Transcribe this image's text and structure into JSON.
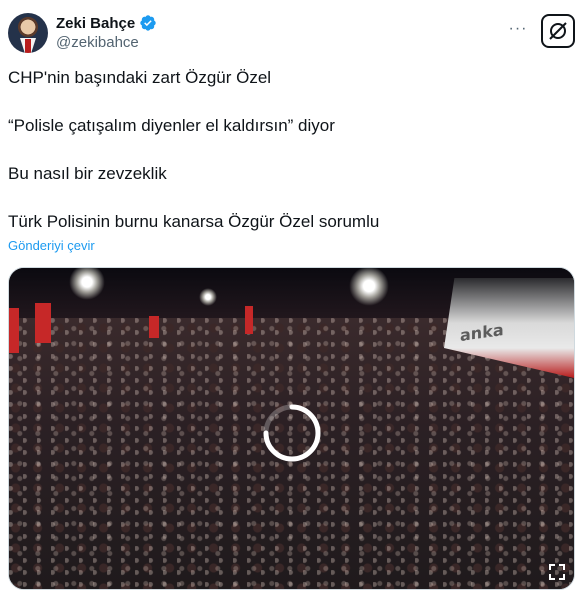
{
  "author": {
    "display_name": "Zeki Bahçe",
    "handle": "@zekibahce",
    "verified": true
  },
  "tweet": {
    "paragraphs": [
      "CHP'nin başındaki zart Özgür Özel",
      "“Polisle çatışalım diyenler el kaldırsın” diyor",
      "Bu nasıl bir zevzeklik",
      "Türk Polisinin burnu kanarsa Özgür Özel sorumlu"
    ],
    "translate_label": "Gönderiyi çevir"
  },
  "media": {
    "type": "video",
    "overlay_text": "anka",
    "state": "loading"
  },
  "icons": {
    "verified": "verified-badge-icon",
    "more": "more-options-icon",
    "grok": "grok-icon",
    "spinner": "loading-spinner-icon"
  },
  "colors": {
    "link": "#1d9bf0",
    "verified": "#1d9bf0",
    "text": "#0f1419",
    "secondary": "#536471"
  }
}
